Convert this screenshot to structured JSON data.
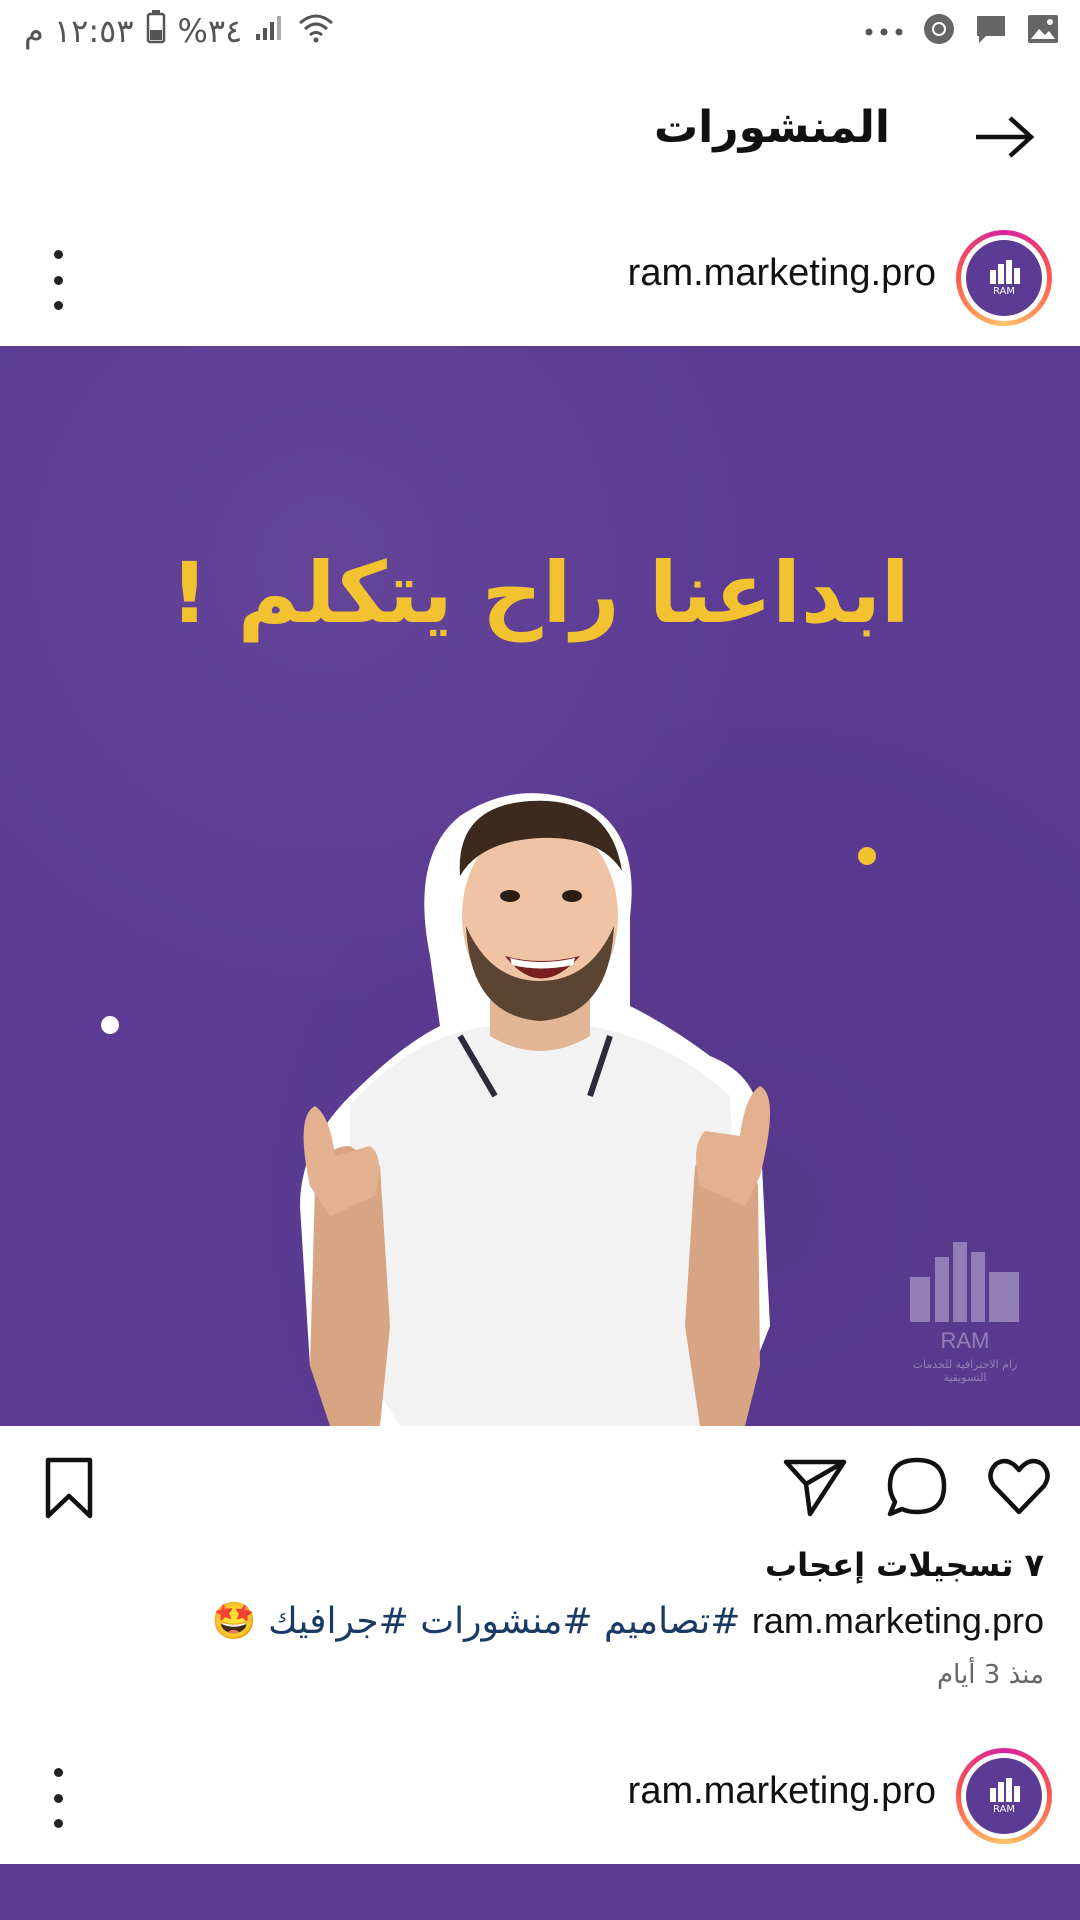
{
  "status_bar": {
    "time": "١٢:٥٣ م",
    "battery": "%٣٤",
    "icons": [
      "battery-icon",
      "signal-icon",
      "wifi-icon",
      "more-dots-icon",
      "chrome-icon",
      "message-icon",
      "gallery-icon"
    ]
  },
  "header": {
    "title": "المنشورات",
    "back_icon": "arrow-right-icon"
  },
  "posts": [
    {
      "username": "ram.marketing.pro",
      "avatar_label": "RAM",
      "image": {
        "headline": "ابداعنا راح يتكلم !",
        "watermark_name": "RAM",
        "watermark_sub": "رام الاحترافية للخدمات التسويقية",
        "colors": {
          "background": "#5b3b93",
          "headline": "#f2c230"
        }
      },
      "likes": "٧ تسجيلات إعجاب",
      "caption_user": "ram.marketing.pro",
      "caption_tags": "#تصاميم #منشورات #جرافيك",
      "caption_emoji": "🤩",
      "time_ago": "منذ 3 أيام",
      "action_icons": [
        "heart-icon",
        "comment-icon",
        "send-icon",
        "bookmark-icon"
      ]
    },
    {
      "username": "ram.marketing.pro",
      "avatar_label": "RAM"
    }
  ]
}
